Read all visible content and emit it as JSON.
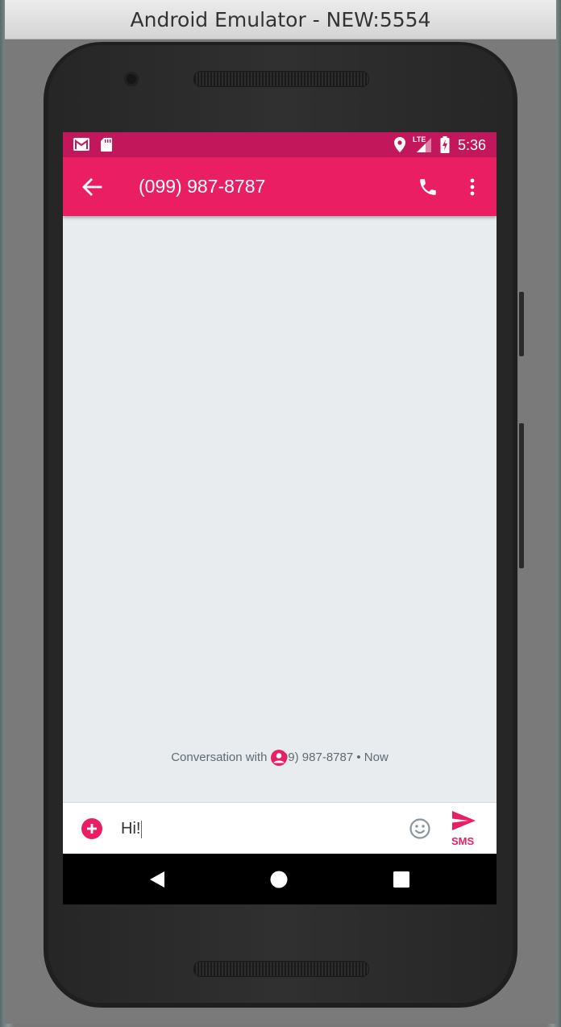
{
  "window": {
    "title": "Android Emulator - NEW:5554"
  },
  "status_bar": {
    "time": "5:36",
    "network": "LTE"
  },
  "app_bar": {
    "title": "(099) 987-8787"
  },
  "conversation": {
    "info": "Conversation with (099) 987-8787 • Now"
  },
  "compose": {
    "text": "Hi!",
    "send_label": "SMS"
  },
  "colors": {
    "primary": "#e91e63",
    "primary_dark": "#c2185b",
    "background": "#e9ecef"
  }
}
